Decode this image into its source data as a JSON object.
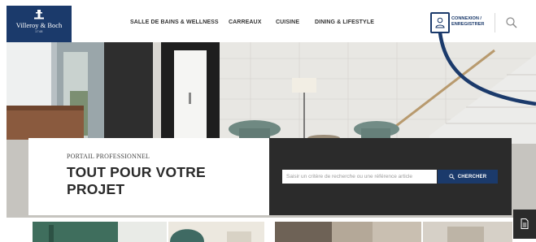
{
  "header": {
    "logo": {
      "brand": "Villeroy & Boch",
      "since": "1748"
    },
    "nav": [
      {
        "label": "SALLE DE BAINS & WELLNESS"
      },
      {
        "label": "CARREAUX"
      },
      {
        "label": "CUISINE"
      },
      {
        "label": "DINING & LIFESTYLE"
      }
    ],
    "account": {
      "line1": "CONNEXION /",
      "line2": "ENREGISTRER",
      "icon": "user-icon"
    },
    "search_icon": "search-icon"
  },
  "hero": {
    "image": "modern interior with white wall tiles, staircase and teal chairs"
  },
  "pro_panel": {
    "subtitle": "PORTAIL PROFESSIONNEL",
    "title": "TOUT POUR VOTRE PROJET"
  },
  "search": {
    "placeholder": "Saisir un critère de recherche ou une référence article",
    "button_label": "CHERCHER",
    "button_icon": "search-icon"
  },
  "floating": {
    "icon": "document-icon"
  },
  "colors": {
    "brand": "#1b3a6b",
    "panel_dark": "#2b2b2b",
    "nav_text": "#333333"
  }
}
